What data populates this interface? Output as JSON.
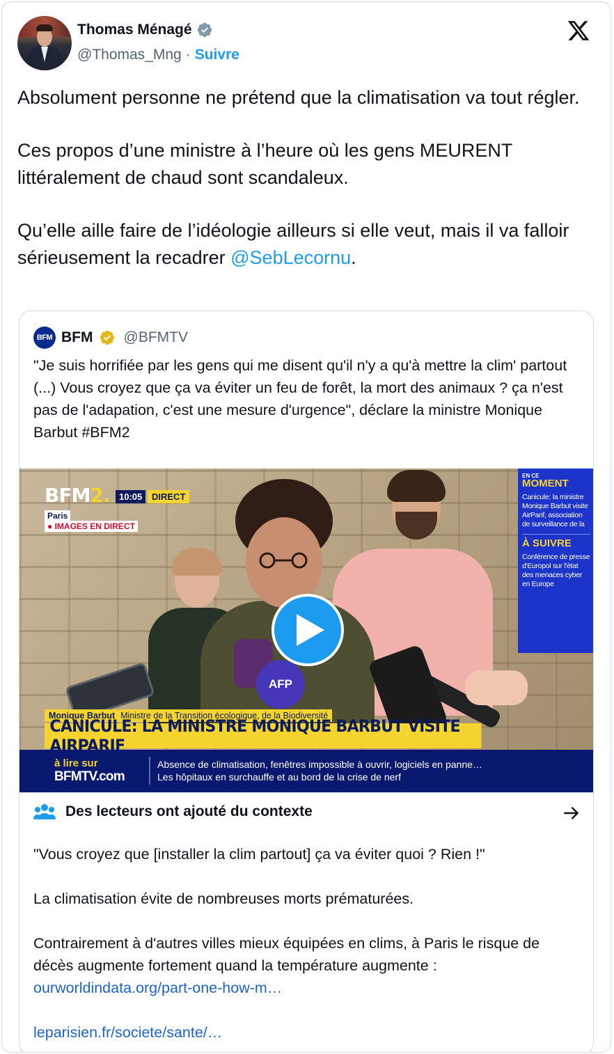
{
  "author": {
    "display_name": "Thomas Ménagé",
    "handle": "@Thomas_Mng",
    "separator": "·",
    "follow_label": "Suivre"
  },
  "tweet": {
    "para1": "Absolument personne ne prétend que la climatisation va tout régler.",
    "para2": "Ces propos d’une ministre à l’heure où les gens MEURENT littéralement de chaud sont scandaleux.",
    "para3_text": "Qu’elle aille faire de l’idéologie ailleurs si elle veut, mais il va falloir sérieusement la recadrer ",
    "para3_mention": "@SebLecornu",
    "para3_end": "."
  },
  "quote": {
    "logo_text": "BFM",
    "name": "BFM",
    "handle": "@BFMTV",
    "text": "\"Je suis horrifiée par les gens qui me disent qu'il n'y a qu'à mettre la clim' partout (...) Vous croyez que ça va éviter un feu de forêt, la mort des animaux ? ça n'est pas de l'adapation, c'est une mesure d'urgence\", déclare la ministre Monique Barbut #BFM2"
  },
  "video": {
    "channel_logo": "BFM2",
    "time": "10:05",
    "live_label": "DIRECT",
    "location": "Paris",
    "live_images": "● IMAGES EN DIRECT",
    "mic_afp": "AFP",
    "sidebar": {
      "kicker": "EN CE",
      "moment_label": "MOMENT",
      "moment_text": "Canicule: la ministre Monique Barbut visite AirParif, association de surveillance de la",
      "next_label": "À SUIVRE",
      "next_text": "Conférence de presse d'Europol sur l'état des menaces cyber en Europe"
    },
    "name_strip_name": "Monique Barbut",
    "name_strip_title": "Ministre de la Transition écologique, de la Biodiversité",
    "headline": "CANICULE: LA MINISTRE MONIQUE BARBUT VISITE AIRPARIF",
    "read_on": "à lire sur",
    "read_site": "BFMTV.com",
    "ticker_line1": "Absence de climatisation, fenêtres impossible à ouvrir, logiciels en panne…",
    "ticker_line2": "Les hôpitaux en surchauffe et au bord de la crise de nerf"
  },
  "community_note": {
    "title": "Des lecteurs ont ajouté du contexte",
    "line1": "\"Vous croyez que [installer la clim partout] ça va éviter quoi ? Rien !\"",
    "line2": "La climatisation évite de nombreuses morts prématurées.",
    "line3": "Contrairement à d'autres villes mieux équipées en clims, à Paris le risque de décès augmente fortement quand la température augmente :",
    "link1": "ourworldindata.org/part-one-how-m…",
    "link2": "leparisien.fr/societe/sante/…"
  },
  "colors": {
    "link": "#1d9bf0",
    "note_link": "#1d63c8",
    "text": "#0f1419",
    "secondary": "#536471",
    "bfm_yellow": "#f5d430",
    "bfm_blue": "#0a1970"
  }
}
